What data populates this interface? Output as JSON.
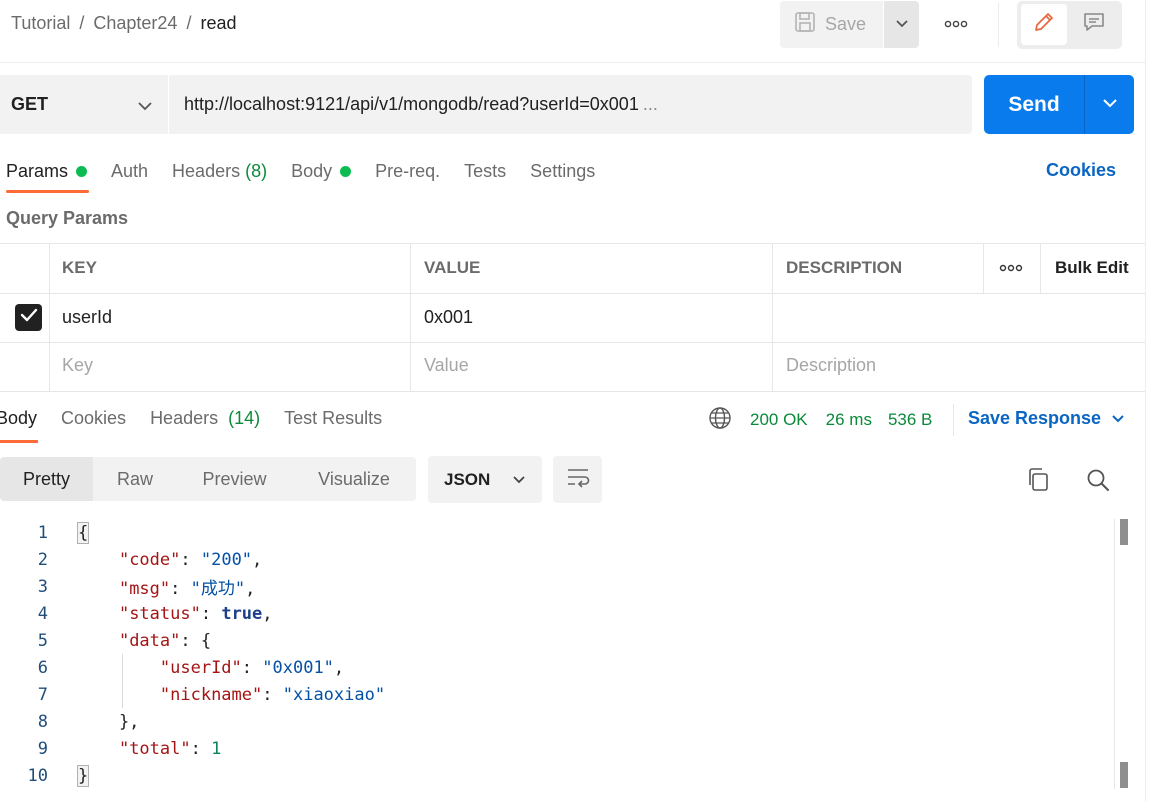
{
  "breadcrumb": {
    "items": [
      "Tutorial",
      "Chapter24"
    ],
    "current": "read",
    "separator": "/"
  },
  "toolbar": {
    "save_label": "Save",
    "more_icon": "more-horizontal-icon",
    "edit_icon": "pencil-icon",
    "comment_icon": "comment-icon"
  },
  "request": {
    "method": "GET",
    "url": "http://localhost:9121/api/v1/mongodb/read?userId=0x001",
    "url_ellipsis": "...",
    "send_label": "Send"
  },
  "request_tabs": {
    "params": "Params",
    "auth": "Auth",
    "headers": "Headers",
    "headers_count": "(8)",
    "body": "Body",
    "prereq": "Pre-req.",
    "tests": "Tests",
    "settings": "Settings",
    "cookies": "Cookies"
  },
  "query_params": {
    "title": "Query Params",
    "headers": {
      "key": "KEY",
      "value": "VALUE",
      "description": "DESCRIPTION",
      "bulk_edit": "Bulk Edit"
    },
    "rows": [
      {
        "key": "userId",
        "value": "0x001",
        "description": "",
        "checked": true
      }
    ],
    "placeholders": {
      "key": "Key",
      "value": "Value",
      "description": "Description"
    }
  },
  "response": {
    "tabs": {
      "body": "Body",
      "cookies": "Cookies",
      "headers": "Headers",
      "headers_count": "(14)",
      "test_results": "Test Results"
    },
    "status": "200 OK",
    "time": "26 ms",
    "size": "536 B",
    "save_response": "Save Response",
    "views": [
      "Pretty",
      "Raw",
      "Preview",
      "Visualize"
    ],
    "format": "JSON",
    "lines": [
      "1",
      "2",
      "3",
      "4",
      "5",
      "6",
      "7",
      "8",
      "9",
      "10"
    ],
    "json": {
      "code_key": "\"code\"",
      "code_val": "\"200\"",
      "msg_key": "\"msg\"",
      "msg_val": "\"成功\"",
      "status_key": "\"status\"",
      "status_val": "true",
      "data_key": "\"data\"",
      "userId_key": "\"userId\"",
      "userId_val": "\"0x001\"",
      "nickname_key": "\"nickname\"",
      "nickname_val": "\"xiaoxiao\"",
      "total_key": "\"total\"",
      "total_val": "1"
    }
  },
  "colors": {
    "accent": "#ff6c37",
    "primary": "#097bed",
    "success": "#0cbb52"
  }
}
